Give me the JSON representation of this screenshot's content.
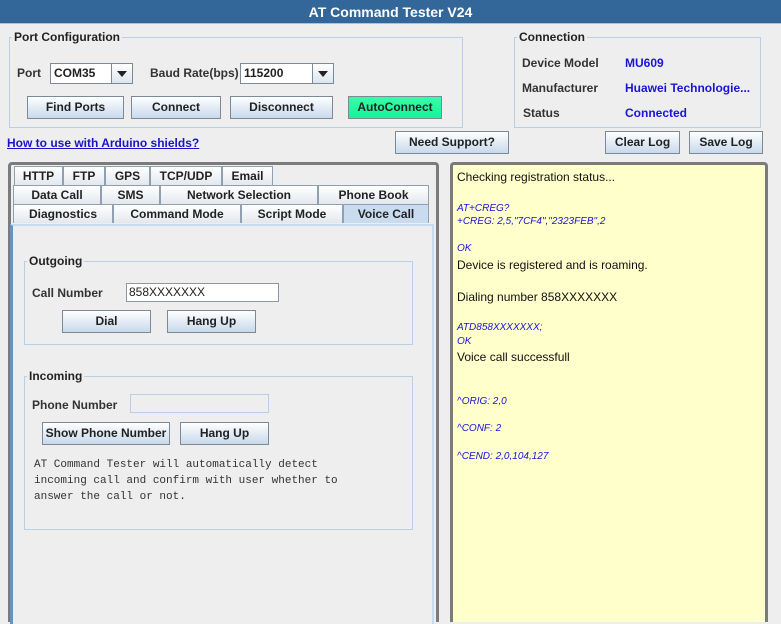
{
  "window": {
    "title": "AT Command Tester V24"
  },
  "port_config": {
    "legend": "Port Configuration",
    "port_label": "Port",
    "port_value": "COM35",
    "baud_label": "Baud Rate(bps)",
    "baud_value": "115200",
    "buttons": {
      "find_ports": "Find Ports",
      "connect": "Connect",
      "disconnect": "Disconnect",
      "autoconnect": "AutoConnect"
    }
  },
  "connection": {
    "legend": "Connection",
    "device_model_label": "Device Model",
    "device_model_value": "MU609",
    "manufacturer_label": "Manufacturer",
    "manufacturer_value": "Huawei Technologie...",
    "status_label": "Status",
    "status_value": "Connected"
  },
  "links": {
    "arduino_help": "How to use with Arduino shields?"
  },
  "toolbar": {
    "need_support": "Need Support?",
    "clear_log": "Clear Log",
    "save_log": "Save Log"
  },
  "tabs": {
    "row1": [
      "HTTP",
      "FTP",
      "GPS",
      "TCP/UDP",
      "Email"
    ],
    "row2": [
      "Data Call",
      "SMS",
      "Network Selection",
      "Phone Book"
    ],
    "row3": [
      "Diagnostics",
      "Command Mode",
      "Script Mode",
      "Voice Call"
    ],
    "active": "Voice Call"
  },
  "voice_call": {
    "outgoing": {
      "legend": "Outgoing",
      "call_number_label": "Call Number",
      "call_number_value": "858XXXXXXX",
      "dial": "Dial",
      "hang_up": "Hang Up"
    },
    "incoming": {
      "legend": "Incoming",
      "phone_number_label": "Phone Number",
      "phone_number_value": "",
      "show_phone_number": "Show Phone Number",
      "hang_up": "Hang Up",
      "info_lines": [
        "AT Command Tester will automatically detect",
        "incoming call and confirm with user whether to",
        "answer the call or not."
      ]
    }
  },
  "log": {
    "lines": [
      {
        "type": "plain",
        "text": "Checking registration status..."
      },
      {
        "type": "cmd",
        "text": "AT+CREG?"
      },
      {
        "type": "cmd",
        "text": "+CREG: 2,5,\"7CF4\",\"2323FEB\",2"
      },
      {
        "type": "cmd",
        "text": "OK"
      },
      {
        "type": "plain",
        "text": "Device is registered and is roaming."
      },
      {
        "type": "plain",
        "text": "Dialing number 858XXXXXXX"
      },
      {
        "type": "cmd",
        "text": "ATD858XXXXXXX;"
      },
      {
        "type": "cmd",
        "text": "OK"
      },
      {
        "type": "plain",
        "text": "Voice call successfull"
      },
      {
        "type": "cmd",
        "text": "^ORIG: 2,0"
      },
      {
        "type": "cmd",
        "text": "^CONF: 2"
      },
      {
        "type": "cmd",
        "text": "^CEND: 2,0,104,127"
      }
    ]
  },
  "colors": {
    "title_bar": "#336699",
    "value_blue": "#1a14d6",
    "autoconnect_green": "#1af19a",
    "log_bg": "#ffffcc",
    "active_tab": "#c8dbef"
  }
}
